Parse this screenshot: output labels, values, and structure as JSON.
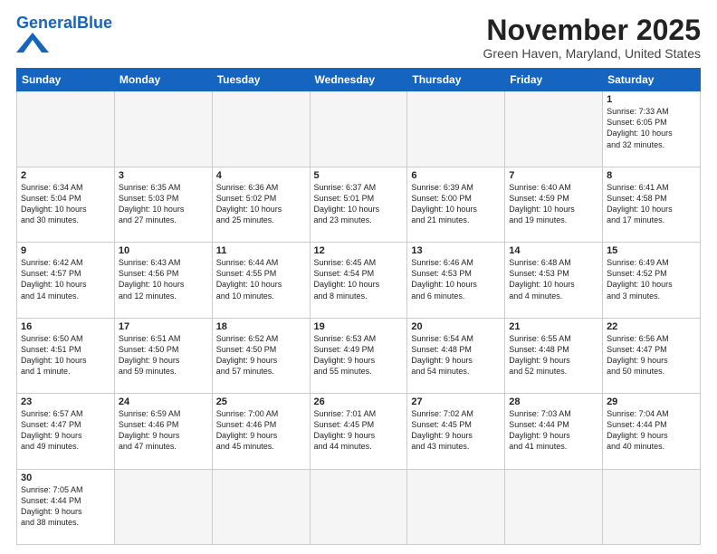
{
  "header": {
    "logo_general": "General",
    "logo_blue": "Blue",
    "month_title": "November 2025",
    "subtitle": "Green Haven, Maryland, United States"
  },
  "weekdays": [
    "Sunday",
    "Monday",
    "Tuesday",
    "Wednesday",
    "Thursday",
    "Friday",
    "Saturday"
  ],
  "weeks": [
    [
      {
        "day": "",
        "info": "",
        "empty": true
      },
      {
        "day": "",
        "info": "",
        "empty": true
      },
      {
        "day": "",
        "info": "",
        "empty": true
      },
      {
        "day": "",
        "info": "",
        "empty": true
      },
      {
        "day": "",
        "info": "",
        "empty": true
      },
      {
        "day": "",
        "info": "",
        "empty": true
      },
      {
        "day": "1",
        "info": "Sunrise: 7:33 AM\nSunset: 6:05 PM\nDaylight: 10 hours\nand 32 minutes."
      }
    ],
    [
      {
        "day": "2",
        "info": "Sunrise: 6:34 AM\nSunset: 5:04 PM\nDaylight: 10 hours\nand 30 minutes."
      },
      {
        "day": "3",
        "info": "Sunrise: 6:35 AM\nSunset: 5:03 PM\nDaylight: 10 hours\nand 27 minutes."
      },
      {
        "day": "4",
        "info": "Sunrise: 6:36 AM\nSunset: 5:02 PM\nDaylight: 10 hours\nand 25 minutes."
      },
      {
        "day": "5",
        "info": "Sunrise: 6:37 AM\nSunset: 5:01 PM\nDaylight: 10 hours\nand 23 minutes."
      },
      {
        "day": "6",
        "info": "Sunrise: 6:39 AM\nSunset: 5:00 PM\nDaylight: 10 hours\nand 21 minutes."
      },
      {
        "day": "7",
        "info": "Sunrise: 6:40 AM\nSunset: 4:59 PM\nDaylight: 10 hours\nand 19 minutes."
      },
      {
        "day": "8",
        "info": "Sunrise: 6:41 AM\nSunset: 4:58 PM\nDaylight: 10 hours\nand 17 minutes."
      }
    ],
    [
      {
        "day": "9",
        "info": "Sunrise: 6:42 AM\nSunset: 4:57 PM\nDaylight: 10 hours\nand 14 minutes."
      },
      {
        "day": "10",
        "info": "Sunrise: 6:43 AM\nSunset: 4:56 PM\nDaylight: 10 hours\nand 12 minutes."
      },
      {
        "day": "11",
        "info": "Sunrise: 6:44 AM\nSunset: 4:55 PM\nDaylight: 10 hours\nand 10 minutes."
      },
      {
        "day": "12",
        "info": "Sunrise: 6:45 AM\nSunset: 4:54 PM\nDaylight: 10 hours\nand 8 minutes."
      },
      {
        "day": "13",
        "info": "Sunrise: 6:46 AM\nSunset: 4:53 PM\nDaylight: 10 hours\nand 6 minutes."
      },
      {
        "day": "14",
        "info": "Sunrise: 6:48 AM\nSunset: 4:53 PM\nDaylight: 10 hours\nand 4 minutes."
      },
      {
        "day": "15",
        "info": "Sunrise: 6:49 AM\nSunset: 4:52 PM\nDaylight: 10 hours\nand 3 minutes."
      }
    ],
    [
      {
        "day": "16",
        "info": "Sunrise: 6:50 AM\nSunset: 4:51 PM\nDaylight: 10 hours\nand 1 minute."
      },
      {
        "day": "17",
        "info": "Sunrise: 6:51 AM\nSunset: 4:50 PM\nDaylight: 9 hours\nand 59 minutes."
      },
      {
        "day": "18",
        "info": "Sunrise: 6:52 AM\nSunset: 4:50 PM\nDaylight: 9 hours\nand 57 minutes."
      },
      {
        "day": "19",
        "info": "Sunrise: 6:53 AM\nSunset: 4:49 PM\nDaylight: 9 hours\nand 55 minutes."
      },
      {
        "day": "20",
        "info": "Sunrise: 6:54 AM\nSunset: 4:48 PM\nDaylight: 9 hours\nand 54 minutes."
      },
      {
        "day": "21",
        "info": "Sunrise: 6:55 AM\nSunset: 4:48 PM\nDaylight: 9 hours\nand 52 minutes."
      },
      {
        "day": "22",
        "info": "Sunrise: 6:56 AM\nSunset: 4:47 PM\nDaylight: 9 hours\nand 50 minutes."
      }
    ],
    [
      {
        "day": "23",
        "info": "Sunrise: 6:57 AM\nSunset: 4:47 PM\nDaylight: 9 hours\nand 49 minutes."
      },
      {
        "day": "24",
        "info": "Sunrise: 6:59 AM\nSunset: 4:46 PM\nDaylight: 9 hours\nand 47 minutes."
      },
      {
        "day": "25",
        "info": "Sunrise: 7:00 AM\nSunset: 4:46 PM\nDaylight: 9 hours\nand 45 minutes."
      },
      {
        "day": "26",
        "info": "Sunrise: 7:01 AM\nSunset: 4:45 PM\nDaylight: 9 hours\nand 44 minutes."
      },
      {
        "day": "27",
        "info": "Sunrise: 7:02 AM\nSunset: 4:45 PM\nDaylight: 9 hours\nand 43 minutes."
      },
      {
        "day": "28",
        "info": "Sunrise: 7:03 AM\nSunset: 4:44 PM\nDaylight: 9 hours\nand 41 minutes."
      },
      {
        "day": "29",
        "info": "Sunrise: 7:04 AM\nSunset: 4:44 PM\nDaylight: 9 hours\nand 40 minutes."
      }
    ],
    [
      {
        "day": "30",
        "info": "Sunrise: 7:05 AM\nSunset: 4:44 PM\nDaylight: 9 hours\nand 38 minutes."
      },
      {
        "day": "",
        "info": "",
        "empty": true
      },
      {
        "day": "",
        "info": "",
        "empty": true
      },
      {
        "day": "",
        "info": "",
        "empty": true
      },
      {
        "day": "",
        "info": "",
        "empty": true
      },
      {
        "day": "",
        "info": "",
        "empty": true
      },
      {
        "day": "",
        "info": "",
        "empty": true
      }
    ]
  ]
}
